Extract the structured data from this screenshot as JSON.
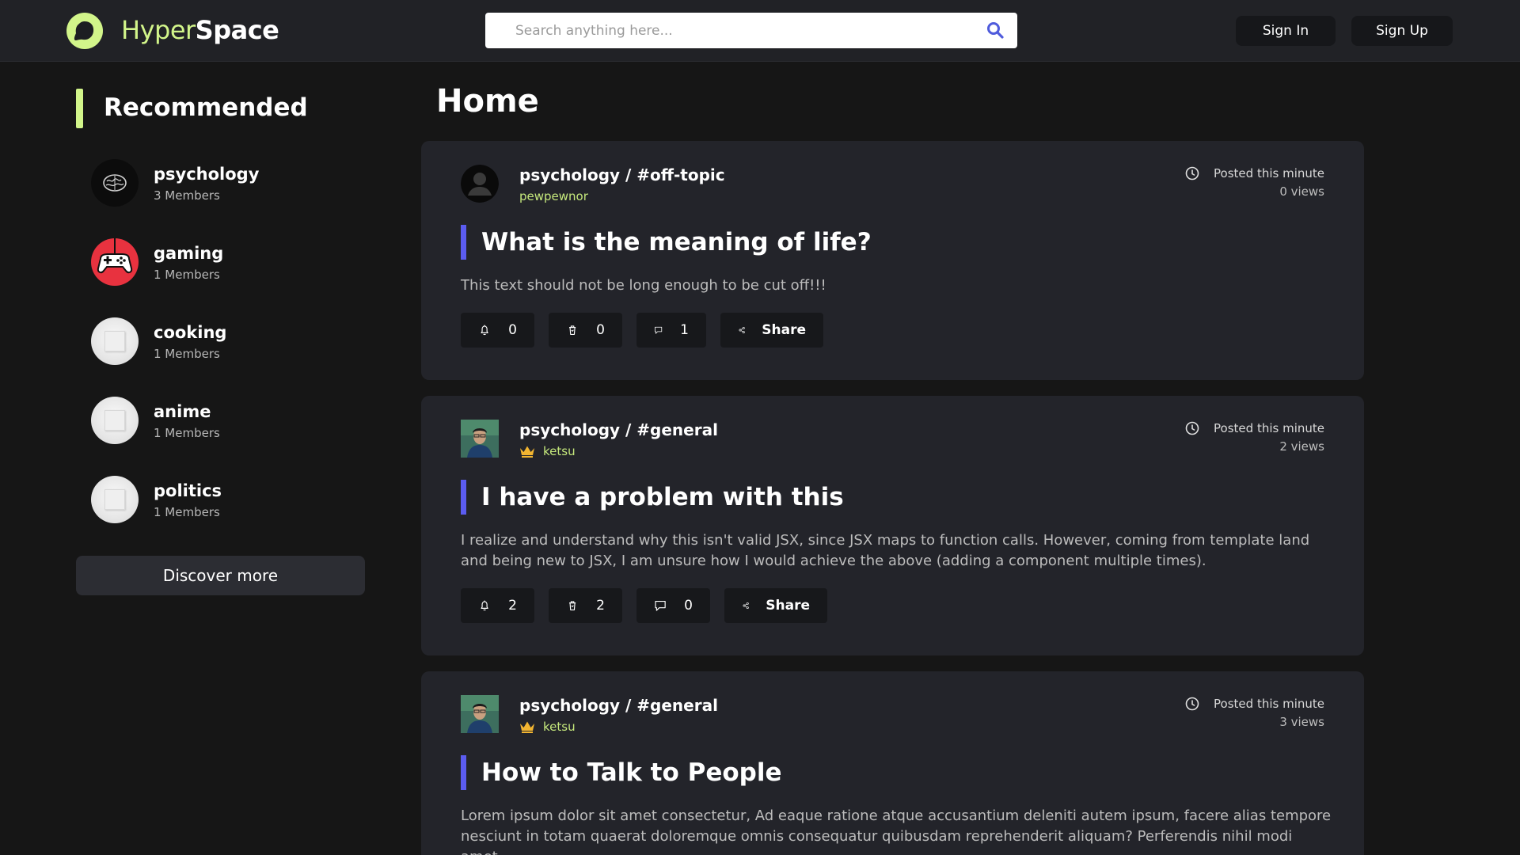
{
  "header": {
    "brand_a": "Hyper",
    "brand_b": "Space",
    "search_placeholder": "Search anything here...",
    "signin": "Sign In",
    "signup": "Sign Up",
    "accent": "#d2f58a"
  },
  "sidebar": {
    "title": "Recommended",
    "communities": [
      {
        "name": "psychology",
        "members": "3 Members",
        "icon": "brain-avatar"
      },
      {
        "name": "gaming",
        "members": "1 Members",
        "icon": "gamepad-avatar"
      },
      {
        "name": "cooking",
        "members": "1 Members",
        "icon": "default-avatar"
      },
      {
        "name": "anime",
        "members": "1 Members",
        "icon": "default-avatar"
      },
      {
        "name": "politics",
        "members": "1 Members",
        "icon": "default-avatar"
      }
    ],
    "discover": "Discover more"
  },
  "main": {
    "title": "Home",
    "posts": [
      {
        "location": "psychology / #off-topic",
        "user": "pewpewnor",
        "time": "Posted this minute",
        "views": "0 views",
        "title": "What is the meaning of life?",
        "body": "This text should not be long enough to be cut off!!!",
        "likes": "0",
        "dislikes": "0",
        "comments": "1",
        "share": "Share"
      },
      {
        "location": "psychology / #general",
        "user": "ketsu",
        "time": "Posted this minute",
        "views": "2 views",
        "title": "I have a problem with this",
        "body": "I realize and understand why this isn't valid JSX, since JSX maps to function calls. However, coming from template land and being new to JSX, I am unsure how I would achieve the above (adding a component multiple times).",
        "likes": "2",
        "dislikes": "2",
        "comments": "0",
        "share": "Share"
      },
      {
        "location": "psychology / #general",
        "user": "ketsu",
        "time": "Posted this minute",
        "views": "3 views",
        "title": "How to Talk to People",
        "body": "Lorem ipsum dolor sit amet consectetur, Ad eaque ratione atque accusantium deleniti autem ipsum, facere alias tempore nesciunt in totam quaerat doloremque omnis consequatur quibusdam reprehenderit aliquam? Perferendis nihil modi amet"
      }
    ]
  }
}
